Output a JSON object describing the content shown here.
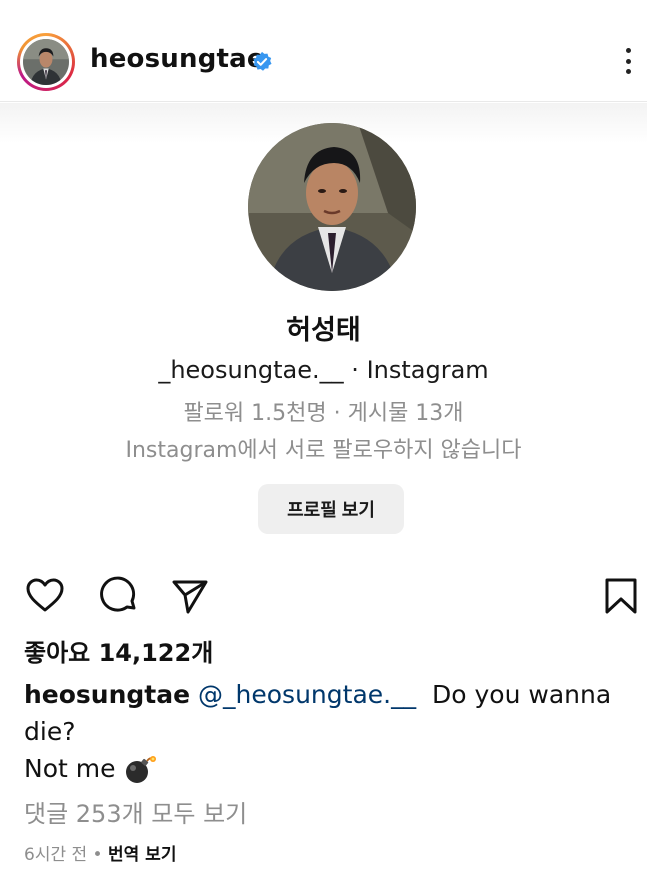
{
  "header": {
    "username": "heosungtae",
    "verified_icon": "verified-badge-icon",
    "more_icon": "more-vertical-icon"
  },
  "embed": {
    "display_name": "허성태",
    "handle": "_heosungtae.__",
    "separator": "·",
    "platform": "Instagram",
    "stats": "팔로워 1.5천명 · 게시물 13개",
    "follow_status": "Instagram에서 서로 팔로우하지 않습니다",
    "view_profile_label": "프로필 보기"
  },
  "actions": {
    "like_icon": "heart-icon",
    "comment_icon": "comment-icon",
    "share_icon": "send-icon",
    "save_icon": "bookmark-icon"
  },
  "post": {
    "likes": "좋아요 14,122개",
    "caption_user": "heosungtae",
    "caption_mention": "@_heosungtae.__",
    "caption_text1": "Do you wanna die?",
    "caption_text2": "Not me",
    "caption_emoji": "bomb-emoji-icon",
    "view_comments": "댓글 253개 모두 보기",
    "time": "6시간 전",
    "dot": "•",
    "translate": "번역 보기"
  },
  "colors": {
    "verified": "#3897f0",
    "mention": "#00376b",
    "secondary_text": "#8e8e8e",
    "button_bg": "#efefef"
  }
}
